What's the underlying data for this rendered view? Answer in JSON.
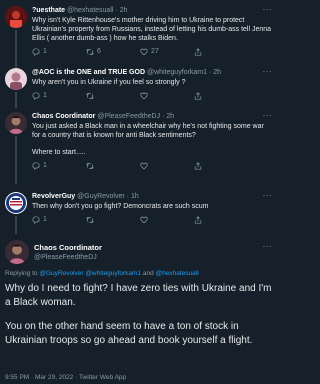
{
  "tweets": [
    {
      "name": "?uesthate",
      "handle": "@hexhatesuall",
      "time": "2h",
      "text": "Why isn't Kyle Rittenhouse's mother driving him to Ukraine to protect Ukrainian's property from Russians, instead of letting his dumb-ass tell Jenna Ellis ( another dumb-ass ) how he stalks Biden.",
      "replies": "1",
      "retweets": "6",
      "likes": "27",
      "avatar_color": "#7a1f1f"
    },
    {
      "name": "@AOC is the ONE and TRUE GOD",
      "handle": "@whiteguyforkam1",
      "time": "2h",
      "text": "Why aren't you in Ukraine if you feel so strongly ?",
      "replies": "1",
      "retweets": "",
      "likes": "",
      "avatar_color": "#c9a3b5"
    },
    {
      "name": "Chaos Coordinator",
      "handle": "@PleaseFeedtheDJ",
      "time": "2h",
      "text_lines": [
        "You just asked a Black man in a wheelchair why he's not fighting some war for a country that is known for anti Black sentiments?",
        "Where to start....."
      ],
      "replies": "1",
      "retweets": "",
      "likes": "",
      "avatar_color": "#6b4a5a"
    },
    {
      "name": "RevolverGuy",
      "handle": "@GuyRevolver",
      "time": "1h",
      "text": "Then why don't you go fight? Demoncrats are such scum",
      "replies": "1",
      "retweets": "",
      "likes": "",
      "avatar_color": "#b22234"
    }
  ],
  "main": {
    "name": "Chaos Coordinator",
    "handle": "@PleaseFeedtheDJ",
    "reply_prefix": "Replying to",
    "reply_handle_1": "@GuyRevolver",
    "reply_handle_2": "@whiteguyforkam1",
    "reply_and": "and",
    "reply_handle_3": "@hexhatesuall",
    "paragraph_1": "Why do I need to fight? I have zero ties with Ukraine and I'm a Black woman.",
    "paragraph_2": "You on the other hand seem to have a ton of stock in Ukrainian troops so go ahead and book yourself a flight.",
    "timestamp": "9:55 PM · Mar 29, 2022 · Twitter Web App",
    "avatar_color": "#6b4a5a"
  },
  "colors": {
    "background": "#15202b",
    "link": "#1d9bf0",
    "muted": "#8b98a5"
  }
}
